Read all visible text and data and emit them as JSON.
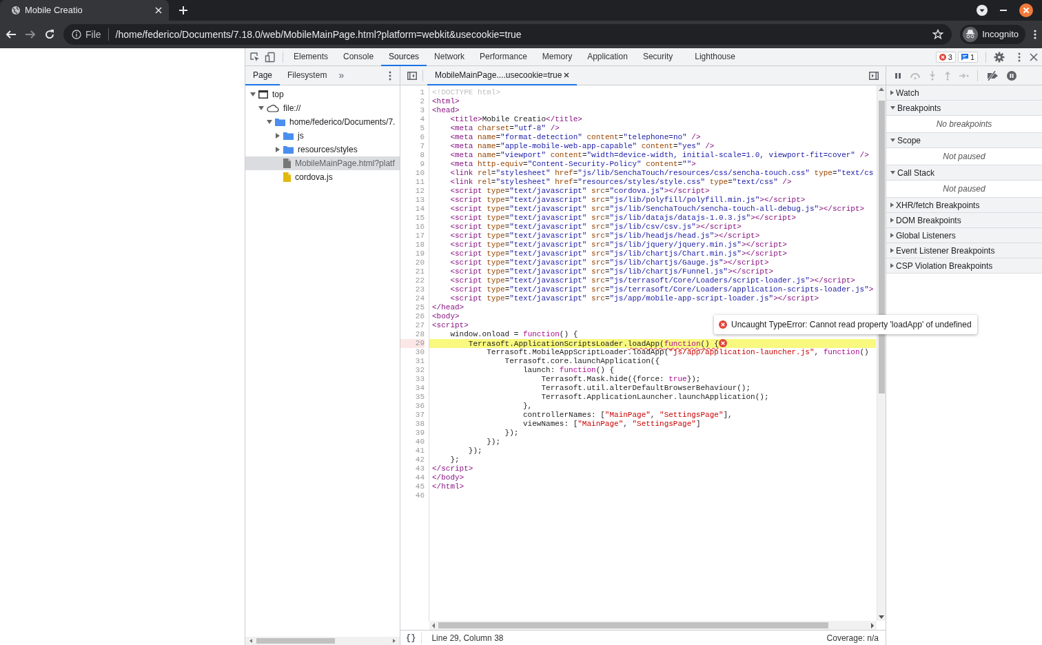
{
  "browser": {
    "tab": {
      "title": "Mobile Creatio",
      "selected": true
    },
    "address": {
      "security_label": "File",
      "url": "/home/federico/Documents/7.18.0/web/MobileMainPage.html?platform=webkit&usecookie=true"
    },
    "profile": "Incognito"
  },
  "devtools": {
    "tabs": [
      {
        "label": "Elements",
        "selected": false
      },
      {
        "label": "Console",
        "selected": false
      },
      {
        "label": "Sources",
        "selected": true
      },
      {
        "label": "Network",
        "selected": false
      },
      {
        "label": "Performance",
        "selected": false
      },
      {
        "label": "Memory",
        "selected": false
      },
      {
        "label": "Application",
        "selected": false
      },
      {
        "label": "Security",
        "selected": false
      },
      {
        "label": "Lighthouse",
        "selected": false
      }
    ],
    "error_count": "3",
    "message_count": "1",
    "navigator": {
      "tabs": [
        {
          "label": "Page",
          "selected": true
        },
        {
          "label": "Filesystem",
          "selected": false
        }
      ],
      "more": "»",
      "tree": [
        {
          "label": "top",
          "kind": "frame",
          "expanded": true,
          "selected": false,
          "children": [
            {
              "label": "file://",
              "kind": "origin",
              "expanded": true,
              "selected": false,
              "children": [
                {
                  "label": "home/federico/Documents/7.",
                  "kind": "folder",
                  "expanded": true,
                  "selected": false,
                  "children": [
                    {
                      "label": "js",
                      "kind": "folder",
                      "expanded": false,
                      "selected": false
                    },
                    {
                      "label": "resources/styles",
                      "kind": "folder",
                      "expanded": false,
                      "selected": false
                    },
                    {
                      "label": "MobileMainPage.html?platf",
                      "kind": "document",
                      "selected": true
                    },
                    {
                      "label": "cordova.js",
                      "kind": "script",
                      "selected": false
                    }
                  ]
                }
              ]
            }
          ]
        }
      ]
    },
    "editor": {
      "tab": {
        "label": "MobileMainPage....usecookie=true",
        "selected": true
      },
      "lines": [
        {
          "number": "1",
          "highlighted": false,
          "segments": [
            {
              "kind": "doctype",
              "text": "<!DOCTYPE html>"
            }
          ]
        },
        {
          "number": "2",
          "highlighted": false,
          "segments": [
            {
              "kind": "tag",
              "text": "<html>"
            }
          ]
        },
        {
          "number": "3",
          "highlighted": false,
          "segments": [
            {
              "kind": "tag",
              "text": "<head>"
            }
          ]
        },
        {
          "number": "4",
          "highlighted": false,
          "segments": [
            {
              "kind": "tag",
              "text": "    <title>"
            },
            {
              "kind": "plain",
              "text": "Mobile Creatio"
            },
            {
              "kind": "tag",
              "text": "</title>"
            }
          ]
        },
        {
          "number": "5",
          "highlighted": false,
          "segments": [
            {
              "kind": "tag",
              "text": "    <meta"
            },
            {
              "kind": "attr",
              "text": " charset"
            },
            {
              "kind": "plain",
              "text": "="
            },
            {
              "kind": "value",
              "text": "\"utf-8\""
            },
            {
              "kind": "tag",
              "text": " />"
            }
          ]
        },
        {
          "number": "6",
          "highlighted": false,
          "segments": [
            {
              "kind": "tag",
              "text": "    <meta"
            },
            {
              "kind": "attr",
              "text": " name"
            },
            {
              "kind": "plain",
              "text": "="
            },
            {
              "kind": "value",
              "text": "\"format-detection\""
            },
            {
              "kind": "attr",
              "text": " content"
            },
            {
              "kind": "plain",
              "text": "="
            },
            {
              "kind": "value",
              "text": "\"telephone=no\""
            },
            {
              "kind": "tag",
              "text": " />"
            }
          ]
        },
        {
          "number": "7",
          "highlighted": false,
          "segments": [
            {
              "kind": "tag",
              "text": "    <meta"
            },
            {
              "kind": "attr",
              "text": " name"
            },
            {
              "kind": "plain",
              "text": "="
            },
            {
              "kind": "value",
              "text": "\"apple-mobile-web-app-capable\""
            },
            {
              "kind": "attr",
              "text": " content"
            },
            {
              "kind": "plain",
              "text": "="
            },
            {
              "kind": "value",
              "text": "\"yes\""
            },
            {
              "kind": "tag",
              "text": " />"
            }
          ]
        },
        {
          "number": "8",
          "highlighted": false,
          "segments": [
            {
              "kind": "tag",
              "text": "    <meta"
            },
            {
              "kind": "attr",
              "text": " name"
            },
            {
              "kind": "plain",
              "text": "="
            },
            {
              "kind": "value",
              "text": "\"viewport\""
            },
            {
              "kind": "attr",
              "text": " content"
            },
            {
              "kind": "plain",
              "text": "="
            },
            {
              "kind": "value",
              "text": "\"width=device-width, initial-scale=1.0, viewport-fit=cover\""
            },
            {
              "kind": "tag",
              "text": " />"
            }
          ]
        },
        {
          "number": "9",
          "highlighted": false,
          "segments": [
            {
              "kind": "tag",
              "text": "    <meta"
            },
            {
              "kind": "attr",
              "text": " http-equiv"
            },
            {
              "kind": "plain",
              "text": "="
            },
            {
              "kind": "value",
              "text": "\"Content-Security-Policy\""
            },
            {
              "kind": "attr",
              "text": " content"
            },
            {
              "kind": "plain",
              "text": "="
            },
            {
              "kind": "value",
              "text": "\"\""
            },
            {
              "kind": "tag",
              "text": ">"
            }
          ]
        },
        {
          "number": "10",
          "highlighted": false,
          "segments": [
            {
              "kind": "tag",
              "text": "    <link"
            },
            {
              "kind": "attr",
              "text": " rel"
            },
            {
              "kind": "plain",
              "text": "="
            },
            {
              "kind": "value",
              "text": "\"stylesheet\""
            },
            {
              "kind": "attr",
              "text": " href"
            },
            {
              "kind": "plain",
              "text": "="
            },
            {
              "kind": "value",
              "text": "\"js/lib/SenchaTouch/resources/css/sencha-touch.css\""
            },
            {
              "kind": "attr",
              "text": " type"
            },
            {
              "kind": "plain",
              "text": "="
            },
            {
              "kind": "value",
              "text": "\"text/cs"
            }
          ]
        },
        {
          "number": "11",
          "highlighted": false,
          "segments": [
            {
              "kind": "tag",
              "text": "    <link"
            },
            {
              "kind": "attr",
              "text": " rel"
            },
            {
              "kind": "plain",
              "text": "="
            },
            {
              "kind": "value",
              "text": "\"stylesheet\""
            },
            {
              "kind": "attr",
              "text": " href"
            },
            {
              "kind": "plain",
              "text": "="
            },
            {
              "kind": "value",
              "text": "\"resources/styles/style.css\""
            },
            {
              "kind": "attr",
              "text": " type"
            },
            {
              "kind": "plain",
              "text": "="
            },
            {
              "kind": "value",
              "text": "\"text/css\""
            },
            {
              "kind": "tag",
              "text": " />"
            }
          ]
        },
        {
          "number": "12",
          "highlighted": false,
          "segments": [
            {
              "kind": "tag",
              "text": "    <script"
            },
            {
              "kind": "attr",
              "text": " type"
            },
            {
              "kind": "plain",
              "text": "="
            },
            {
              "kind": "value",
              "text": "\"text/javascript\""
            },
            {
              "kind": "attr",
              "text": " src"
            },
            {
              "kind": "plain",
              "text": "="
            },
            {
              "kind": "value",
              "text": "\"cordova.js\""
            },
            {
              "kind": "tag",
              "text": "></script>"
            }
          ]
        },
        {
          "number": "13",
          "highlighted": false,
          "segments": [
            {
              "kind": "tag",
              "text": "    <script"
            },
            {
              "kind": "attr",
              "text": " type"
            },
            {
              "kind": "plain",
              "text": "="
            },
            {
              "kind": "value",
              "text": "\"text/javascript\""
            },
            {
              "kind": "attr",
              "text": " src"
            },
            {
              "kind": "plain",
              "text": "="
            },
            {
              "kind": "value",
              "text": "\"js/lib/polyfill/polyfill.min.js\""
            },
            {
              "kind": "tag",
              "text": "></script>"
            }
          ]
        },
        {
          "number": "14",
          "highlighted": false,
          "segments": [
            {
              "kind": "tag",
              "text": "    <script"
            },
            {
              "kind": "attr",
              "text": " type"
            },
            {
              "kind": "plain",
              "text": "="
            },
            {
              "kind": "value",
              "text": "\"text/javascript\""
            },
            {
              "kind": "attr",
              "text": " src"
            },
            {
              "kind": "plain",
              "text": "="
            },
            {
              "kind": "value",
              "text": "\"js/lib/SenchaTouch/sencha-touch-all-debug.js\""
            },
            {
              "kind": "tag",
              "text": "></script>"
            }
          ]
        },
        {
          "number": "15",
          "highlighted": false,
          "segments": [
            {
              "kind": "tag",
              "text": "    <script"
            },
            {
              "kind": "attr",
              "text": " type"
            },
            {
              "kind": "plain",
              "text": "="
            },
            {
              "kind": "value",
              "text": "\"text/javascript\""
            },
            {
              "kind": "attr",
              "text": " src"
            },
            {
              "kind": "plain",
              "text": "="
            },
            {
              "kind": "value",
              "text": "\"js/lib/datajs/datajs-1.0.3.js\""
            },
            {
              "kind": "tag",
              "text": "></script>"
            }
          ]
        },
        {
          "number": "16",
          "highlighted": false,
          "segments": [
            {
              "kind": "tag",
              "text": "    <script"
            },
            {
              "kind": "attr",
              "text": " type"
            },
            {
              "kind": "plain",
              "text": "="
            },
            {
              "kind": "value",
              "text": "\"text/javascript\""
            },
            {
              "kind": "attr",
              "text": " src"
            },
            {
              "kind": "plain",
              "text": "="
            },
            {
              "kind": "value",
              "text": "\"js/lib/csv/csv.js\""
            },
            {
              "kind": "tag",
              "text": "></script>"
            }
          ]
        },
        {
          "number": "17",
          "highlighted": false,
          "segments": [
            {
              "kind": "tag",
              "text": "    <script"
            },
            {
              "kind": "attr",
              "text": " type"
            },
            {
              "kind": "plain",
              "text": "="
            },
            {
              "kind": "value",
              "text": "\"text/javascript\""
            },
            {
              "kind": "attr",
              "text": " src"
            },
            {
              "kind": "plain",
              "text": "="
            },
            {
              "kind": "value",
              "text": "\"js/lib/headjs/head.js\""
            },
            {
              "kind": "tag",
              "text": "></script>"
            }
          ]
        },
        {
          "number": "18",
          "highlighted": false,
          "segments": [
            {
              "kind": "tag",
              "text": "    <script"
            },
            {
              "kind": "attr",
              "text": " type"
            },
            {
              "kind": "plain",
              "text": "="
            },
            {
              "kind": "value",
              "text": "\"text/javascript\""
            },
            {
              "kind": "attr",
              "text": " src"
            },
            {
              "kind": "plain",
              "text": "="
            },
            {
              "kind": "value",
              "text": "\"js/lib/jquery/jquery.min.js\""
            },
            {
              "kind": "tag",
              "text": "></script>"
            }
          ]
        },
        {
          "number": "19",
          "highlighted": false,
          "segments": [
            {
              "kind": "tag",
              "text": "    <script"
            },
            {
              "kind": "attr",
              "text": " type"
            },
            {
              "kind": "plain",
              "text": "="
            },
            {
              "kind": "value",
              "text": "\"text/javascript\""
            },
            {
              "kind": "attr",
              "text": " src"
            },
            {
              "kind": "plain",
              "text": "="
            },
            {
              "kind": "value",
              "text": "\"js/lib/chartjs/Chart.min.js\""
            },
            {
              "kind": "tag",
              "text": "></script>"
            }
          ]
        },
        {
          "number": "20",
          "highlighted": false,
          "segments": [
            {
              "kind": "tag",
              "text": "    <script"
            },
            {
              "kind": "attr",
              "text": " type"
            },
            {
              "kind": "plain",
              "text": "="
            },
            {
              "kind": "value",
              "text": "\"text/javascript\""
            },
            {
              "kind": "attr",
              "text": " src"
            },
            {
              "kind": "plain",
              "text": "="
            },
            {
              "kind": "value",
              "text": "\"js/lib/chartjs/Gauge.js\""
            },
            {
              "kind": "tag",
              "text": "></script>"
            }
          ]
        },
        {
          "number": "21",
          "highlighted": false,
          "segments": [
            {
              "kind": "tag",
              "text": "    <script"
            },
            {
              "kind": "attr",
              "text": " type"
            },
            {
              "kind": "plain",
              "text": "="
            },
            {
              "kind": "value",
              "text": "\"text/javascript\""
            },
            {
              "kind": "attr",
              "text": " src"
            },
            {
              "kind": "plain",
              "text": "="
            },
            {
              "kind": "value",
              "text": "\"js/lib/chartjs/Funnel.js\""
            },
            {
              "kind": "tag",
              "text": "></script>"
            }
          ]
        },
        {
          "number": "22",
          "highlighted": false,
          "segments": [
            {
              "kind": "tag",
              "text": "    <script"
            },
            {
              "kind": "attr",
              "text": " type"
            },
            {
              "kind": "plain",
              "text": "="
            },
            {
              "kind": "value",
              "text": "\"text/javascript\""
            },
            {
              "kind": "attr",
              "text": " src"
            },
            {
              "kind": "plain",
              "text": "="
            },
            {
              "kind": "value",
              "text": "\"js/terrasoft/Core/Loaders/script-loader.js\""
            },
            {
              "kind": "tag",
              "text": "></script>"
            }
          ]
        },
        {
          "number": "23",
          "highlighted": false,
          "segments": [
            {
              "kind": "tag",
              "text": "    <script"
            },
            {
              "kind": "attr",
              "text": " type"
            },
            {
              "kind": "plain",
              "text": "="
            },
            {
              "kind": "value",
              "text": "\"text/javascript\""
            },
            {
              "kind": "attr",
              "text": " src"
            },
            {
              "kind": "plain",
              "text": "="
            },
            {
              "kind": "value",
              "text": "\"js/terrasoft/Core/Loaders/application-scripts-loader.js\""
            },
            {
              "kind": "tag",
              "text": ">"
            }
          ]
        },
        {
          "number": "24",
          "highlighted": false,
          "segments": [
            {
              "kind": "tag",
              "text": "    <script"
            },
            {
              "kind": "attr",
              "text": " type"
            },
            {
              "kind": "plain",
              "text": "="
            },
            {
              "kind": "value",
              "text": "\"text/javascript\""
            },
            {
              "kind": "attr",
              "text": " src"
            },
            {
              "kind": "plain",
              "text": "="
            },
            {
              "kind": "value",
              "text": "\"js/app/mobile-app-script-loader.js\""
            },
            {
              "kind": "tag",
              "text": "></script>"
            }
          ]
        },
        {
          "number": "25",
          "highlighted": false,
          "segments": [
            {
              "kind": "tag",
              "text": "</head>"
            }
          ]
        },
        {
          "number": "26",
          "highlighted": false,
          "segments": [
            {
              "kind": "tag",
              "text": "<body>"
            }
          ]
        },
        {
          "number": "27",
          "highlighted": false,
          "segments": [
            {
              "kind": "tag",
              "text": "<script>"
            }
          ]
        },
        {
          "number": "28",
          "highlighted": false,
          "segments": [
            {
              "kind": "plain",
              "text": "    window.onload = "
            },
            {
              "kind": "keyword",
              "text": "function"
            },
            {
              "kind": "plain",
              "text": "() {"
            }
          ]
        },
        {
          "number": "29",
          "highlighted": true,
          "segments": [
            {
              "kind": "plain",
              "text": "        Terrasoft.ApplicationScriptsLoader.",
              "underlined": false
            },
            {
              "kind": "plain",
              "text": "loadApp(",
              "underlined": true
            },
            {
              "kind": "keyword",
              "text": "function",
              "underlined": true
            },
            {
              "kind": "plain",
              "text": "() {",
              "underlined": true
            }
          ]
        },
        {
          "number": "30",
          "highlighted": false,
          "segments": [
            {
              "kind": "plain",
              "text": "            Terrasoft.MobileAppScriptLoader.loadApp("
            },
            {
              "kind": "string",
              "text": "\"js/app/application-launcher.js\""
            },
            {
              "kind": "plain",
              "text": ", "
            },
            {
              "kind": "keyword",
              "text": "function"
            },
            {
              "kind": "plain",
              "text": "()"
            }
          ]
        },
        {
          "number": "31",
          "highlighted": false,
          "segments": [
            {
              "kind": "plain",
              "text": "                Terrasoft.core.launchApplication({"
            }
          ]
        },
        {
          "number": "32",
          "highlighted": false,
          "segments": [
            {
              "kind": "plain",
              "text": "                    launch: "
            },
            {
              "kind": "keyword",
              "text": "function"
            },
            {
              "kind": "plain",
              "text": "() {"
            }
          ]
        },
        {
          "number": "33",
          "highlighted": false,
          "segments": [
            {
              "kind": "plain",
              "text": "                        Terrasoft.Mask.hide({force: "
            },
            {
              "kind": "keyword",
              "text": "true"
            },
            {
              "kind": "plain",
              "text": "});"
            }
          ]
        },
        {
          "number": "34",
          "highlighted": false,
          "segments": [
            {
              "kind": "plain",
              "text": "                        Terrasoft.util.alterDefaultBrowserBehaviour();"
            }
          ]
        },
        {
          "number": "35",
          "highlighted": false,
          "segments": [
            {
              "kind": "plain",
              "text": "                        Terrasoft.ApplicationLauncher.launchApplication();"
            }
          ]
        },
        {
          "number": "36",
          "highlighted": false,
          "segments": [
            {
              "kind": "plain",
              "text": "                    },"
            }
          ]
        },
        {
          "number": "37",
          "highlighted": false,
          "segments": [
            {
              "kind": "plain",
              "text": "                    controllerNames: ["
            },
            {
              "kind": "string",
              "text": "\"MainPage\""
            },
            {
              "kind": "plain",
              "text": ", "
            },
            {
              "kind": "string",
              "text": "\"SettingsPage\""
            },
            {
              "kind": "plain",
              "text": "],"
            }
          ]
        },
        {
          "number": "38",
          "highlighted": false,
          "segments": [
            {
              "kind": "plain",
              "text": "                    viewNames: ["
            },
            {
              "kind": "string",
              "text": "\"MainPage\""
            },
            {
              "kind": "plain",
              "text": ", "
            },
            {
              "kind": "string",
              "text": "\"SettingsPage\""
            },
            {
              "kind": "plain",
              "text": "]"
            }
          ]
        },
        {
          "number": "39",
          "highlighted": false,
          "segments": [
            {
              "kind": "plain",
              "text": "                });"
            }
          ]
        },
        {
          "number": "40",
          "highlighted": false,
          "segments": [
            {
              "kind": "plain",
              "text": "            });"
            }
          ]
        },
        {
          "number": "41",
          "highlighted": false,
          "segments": [
            {
              "kind": "plain",
              "text": "        });"
            }
          ]
        },
        {
          "number": "42",
          "highlighted": false,
          "segments": [
            {
              "kind": "plain",
              "text": "    };"
            }
          ]
        },
        {
          "number": "43",
          "highlighted": false,
          "segments": [
            {
              "kind": "tag",
              "text": "</script>"
            }
          ]
        },
        {
          "number": "44",
          "highlighted": false,
          "segments": [
            {
              "kind": "tag",
              "text": "</body>"
            }
          ]
        },
        {
          "number": "45",
          "highlighted": false,
          "segments": [
            {
              "kind": "tag",
              "text": "</html>"
            }
          ]
        },
        {
          "number": "46",
          "highlighted": false
        }
      ],
      "error_message": "Uncaught TypeError: Cannot read property 'loadApp' of undefined",
      "format_button": "{}",
      "cursor_position": "Line 29, Column 38",
      "coverage": "Coverage: n/a"
    },
    "debugger": {
      "sections": [
        {
          "title": "Watch",
          "expanded": false
        },
        {
          "title": "Breakpoints",
          "expanded": true,
          "message": "No breakpoints"
        },
        {
          "title": "Scope",
          "expanded": true,
          "message": "Not paused"
        },
        {
          "title": "Call Stack",
          "expanded": true,
          "message": "Not paused"
        },
        {
          "title": "XHR/fetch Breakpoints",
          "expanded": false
        },
        {
          "title": "DOM Breakpoints",
          "expanded": false
        },
        {
          "title": "Global Listeners",
          "expanded": false
        },
        {
          "title": "Event Listener Breakpoints",
          "expanded": false
        },
        {
          "title": "CSP Violation Breakpoints",
          "expanded": false
        }
      ]
    }
  }
}
